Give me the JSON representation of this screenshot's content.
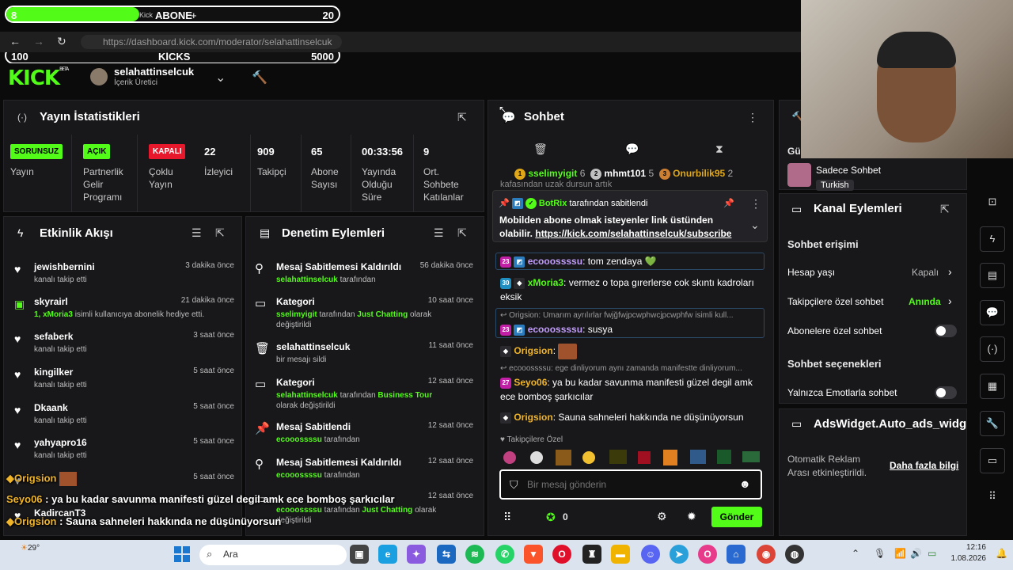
{
  "overlay": {
    "subs_bar": {
      "left": "8",
      "mid_small": "Kick",
      "label": "ABONE",
      "plus": "+",
      "right": "20",
      "progress": 0.4
    },
    "kicks_bar": {
      "left": "100",
      "label": "KİCKS",
      "right": "5000",
      "progress": 0
    },
    "chat_overlay": [
      {
        "user": "Origsion",
        "text": ""
      },
      {
        "user": "Seyo06",
        "text": " : ya bu kadar savunma manifesti güzel degil amk ece bomboş şarkıcılar"
      },
      {
        "user": "Origsion",
        "text": " : Sauna sahneleri hakkında ne düşünüyorsun"
      }
    ]
  },
  "browser": {
    "url": "https://dashboard.kick.com/moderator/selahattinselcuk"
  },
  "header": {
    "logo": "KICK",
    "beta": "BETA",
    "username": "selahattinselcuk",
    "role": "İçerik Üretici"
  },
  "stats": {
    "title": "Yayın İstatistikleri",
    "items": [
      {
        "tag": "SORUNSUZ",
        "label": "Yayın"
      },
      {
        "tag": "AÇIK",
        "label": "Partnerlik Gelir Programı"
      },
      {
        "tag": "KAPALI",
        "label": "Çoklu Yayın"
      }
    ],
    "values": [
      {
        "value": "22",
        "label": "İzleyici"
      },
      {
        "value": "909",
        "label": "Takipçi"
      },
      {
        "value": "65",
        "label": "Abone Sayısı"
      },
      {
        "value": "00:33:56",
        "label": "Yayında Olduğu Süre"
      },
      {
        "value": "9",
        "label": "Ort. Sohbete Katılanlar"
      }
    ]
  },
  "activity": {
    "title": "Etkinlik Akışı",
    "rows": [
      {
        "name": "jewishbernini",
        "sub": "kanalı takip etti",
        "time": "3 dakika önce"
      },
      {
        "name": "skyrairl",
        "sub_green": "1, xMoria3",
        "sub": " isimli kullanıcıya abonelik hediye etti.",
        "time": "21 dakika önce"
      },
      {
        "name": "sefaberk",
        "sub": "kanalı takip etti",
        "time": "3 saat önce"
      },
      {
        "name": "kingilker",
        "sub": "kanalı takip etti",
        "time": "5 saat önce"
      },
      {
        "name": "Dkaank",
        "sub": "kanalı takip etti",
        "time": "5 saat önce"
      },
      {
        "name": "yahyapro16",
        "sub": "kanalı takip etti",
        "time": "5 saat önce"
      },
      {
        "name": "",
        "sub": "",
        "time": "5 saat önce"
      },
      {
        "name": "KadircanT3",
        "sub": "",
        "time": ""
      }
    ]
  },
  "moderation": {
    "title": "Denetim Eylemleri",
    "rows": [
      {
        "name": "Mesaj Sabitlemesi Kaldırıldı",
        "g1": "selahattinselcuk",
        "t1": " tarafından",
        "time": "56 dakika önce"
      },
      {
        "name": "Kategori",
        "g1": "sselimyigit",
        "t1": " tarafından ",
        "g2": "Just Chatting",
        "t2": " olarak değiştirildi",
        "time": "10 saat önce"
      },
      {
        "name": "selahattinselcuk",
        "t1": "bir mesajı sildi",
        "time": "11 saat önce"
      },
      {
        "name": "Kategori",
        "g1": "selahattinselcuk",
        "t1": " tarafından ",
        "g2": "Business Tour",
        "t2": " olarak değiştirildi",
        "time": "12 saat önce"
      },
      {
        "name": "Mesaj Sabitlendi",
        "g1": "ecooossssu",
        "t1": " tarafından",
        "time": "12 saat önce"
      },
      {
        "name": "Mesaj Sabitlemesi Kaldırıldı",
        "g1": "ecooossssu",
        "t1": " tarafından",
        "time": "12 saat önce"
      },
      {
        "name": "",
        "g1": "ecooossssu",
        "t1": " tarafından ",
        "g2": "Just Chatting",
        "t2": " olarak değiştirildi",
        "time": "12 saat önce"
      }
    ]
  },
  "chat": {
    "title": "Sohbet",
    "top": [
      {
        "rank": "1",
        "name": "sselimyigit",
        "count": "6"
      },
      {
        "rank": "2",
        "name": "mhmt101",
        "count": "5"
      },
      {
        "rank": "3",
        "name": "Onurbilik95",
        "count": "2"
      }
    ],
    "behind_text": "kafasından uzak dursun artık",
    "pinned": {
      "by": "BotRix",
      "by_suffix": " tarafından sabitlendi",
      "text": "Mobilden abone olmak isteyenler link üstünden olabilir. ",
      "link": "https://kick.com/selahattinselcuk/subscribe"
    },
    "messages": [
      {
        "badge": "23",
        "user": "ecooossssu",
        "text": ": tom zendaya 💚"
      },
      {
        "badge": "30",
        "user": "xMoria3",
        "text": ": vermez o topa gırerlerse cok skıntı kadroları eksik"
      },
      {
        "reply": "Origsion: Umarım ayrılırlar fwjğfwjpcwphwcjpcwphfw isimli kull...",
        "badge": "23",
        "user": "ecooossssu",
        "text": ": susya"
      },
      {
        "user": "Origsion",
        "text": ":"
      },
      {
        "reply": "ecooossssu: ege dinliyorum aynı zamanda manifestte dinliyorum...",
        "badge": "27",
        "user": "Seyo06",
        "text": ": ya bu kadar savunma manifesti güzel degil amk ece bomboş şarkıcılar"
      },
      {
        "user": "Origsion",
        "text": ": Sauna sahneleri hakkında ne düşünüyorsun"
      }
    ],
    "followers_only": "Takipçilere Özel",
    "placeholder": "Bir mesaj gönderin",
    "kicks_count": "0",
    "send_label": "Gönder"
  },
  "community": {
    "header_short": "Gü",
    "name": "Sadece Sohbet",
    "lang": "Turkish"
  },
  "channel_actions": {
    "title": "Kanal Eylemleri",
    "access_title": "Sohbet erişimi",
    "rows": [
      {
        "label": "Hesap yaşı",
        "value": "Kapalı"
      },
      {
        "label": "Takipçilere özel sohbet",
        "value": "Anında"
      },
      {
        "label": "Abonelere özel sohbet",
        "value": ""
      }
    ],
    "options_title": "Sohbet seçenekleri",
    "emote_only": "Yalnızca Emotlarla sohbet"
  },
  "ads": {
    "title": "AdsWidget.Auto_ads_widg",
    "desc": "Otomatik Reklam Arası etkinleştirildi.",
    "link": "Daha fazla bilgi"
  },
  "taskbar": {
    "weather": "29°",
    "search": "Ara",
    "time": "12:16",
    "date": "1.08.2026"
  },
  "colors": {
    "accent": "#53fc18",
    "panel": "#18181b",
    "bg": "#0b0b0c"
  }
}
